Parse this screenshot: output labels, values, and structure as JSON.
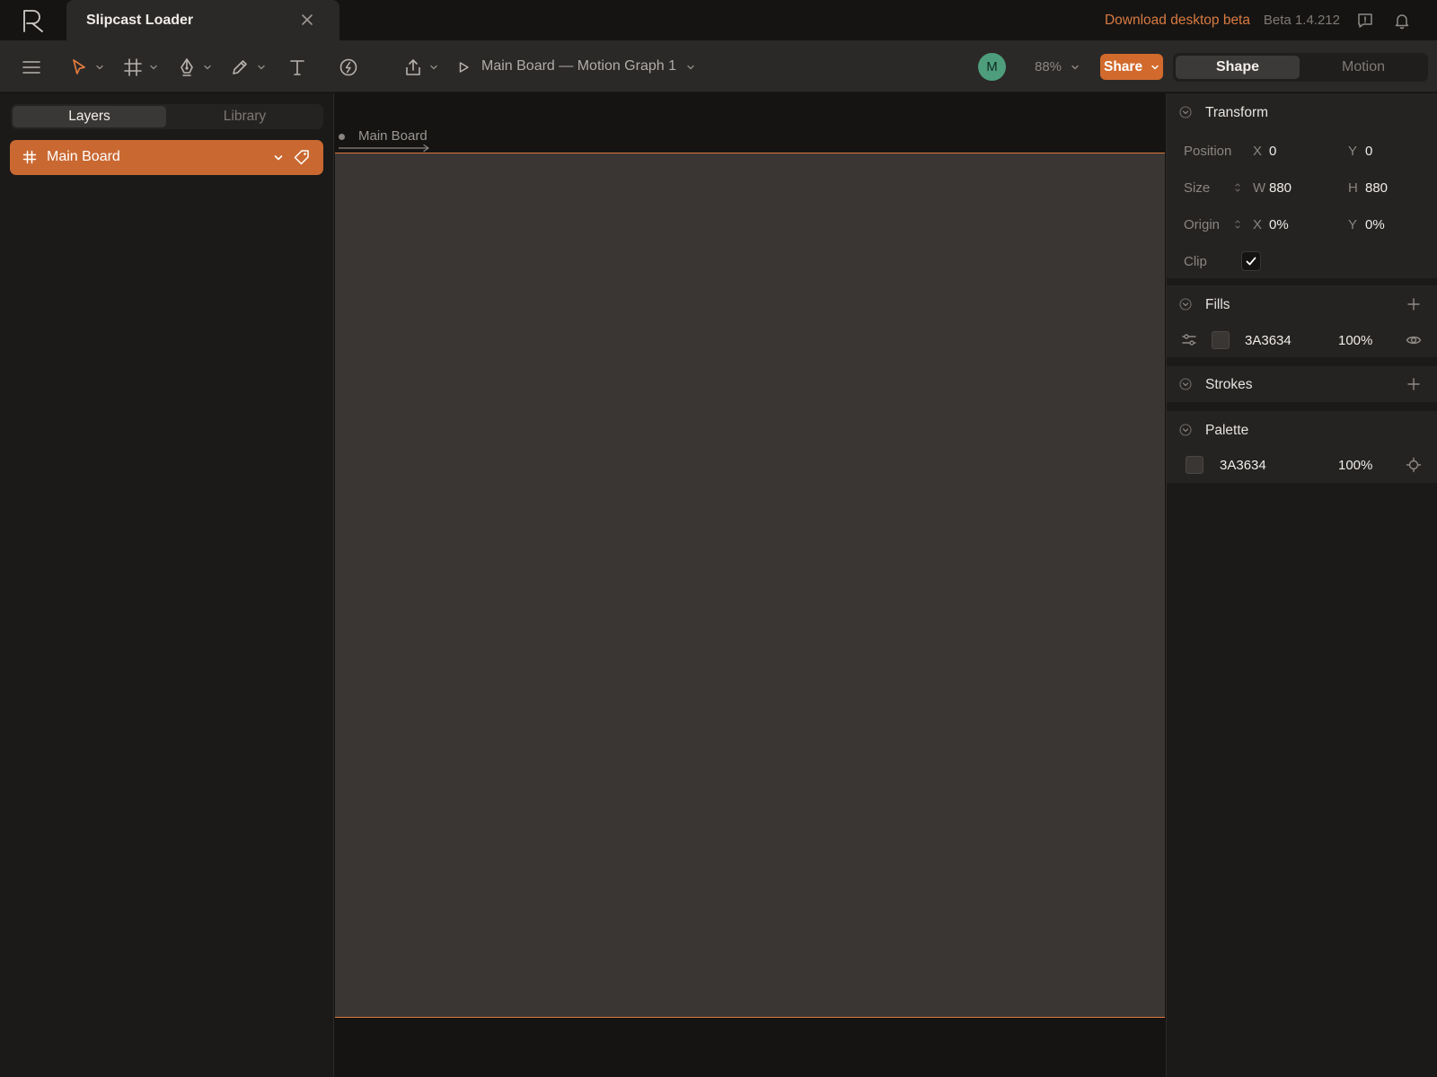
{
  "app": {
    "document_title": "Slipcast Loader",
    "download_label": "Download desktop beta",
    "version": "Beta 1.4.212"
  },
  "toolbar": {
    "breadcrumb": "Main Board — Motion Graph 1",
    "avatar_initial": "M",
    "zoom": "88%",
    "share_label": "Share",
    "mode_tabs": [
      "Shape",
      "Motion"
    ],
    "active_mode": "Shape"
  },
  "left_panel": {
    "tabs": [
      "Layers",
      "Library"
    ],
    "active_tab": "Layers",
    "layers": [
      {
        "name": "Main Board",
        "type": "board",
        "selected": true
      }
    ]
  },
  "canvas": {
    "board_label": "Main Board",
    "board_fill": "#3A3634",
    "selection_color": "#e07a3d"
  },
  "inspector": {
    "transform": {
      "title": "Transform",
      "position_label": "Position",
      "size_label": "Size",
      "origin_label": "Origin",
      "clip_label": "Clip",
      "position": {
        "x_axis": "X",
        "x": "0",
        "y_axis": "Y",
        "y": "0"
      },
      "size": {
        "w_axis": "W",
        "w": "880",
        "h_axis": "H",
        "h": "880"
      },
      "origin": {
        "x_axis": "X",
        "x": "0%",
        "y_axis": "Y",
        "y": "0%"
      },
      "clip": true
    },
    "fills": {
      "title": "Fills",
      "items": [
        {
          "hex": "3A3634",
          "opacity": "100%",
          "visible": true
        }
      ]
    },
    "strokes": {
      "title": "Strokes"
    },
    "palette": {
      "title": "Palette",
      "items": [
        {
          "hex": "3A3634",
          "opacity": "100%"
        }
      ]
    }
  },
  "colors": {
    "accent": "#d16a2c",
    "panel": "#252322",
    "avatar": "#4e9e7c"
  }
}
